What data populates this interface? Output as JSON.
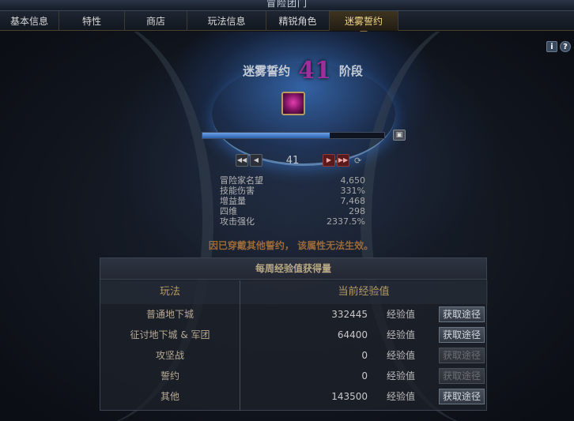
{
  "window": {
    "title": "冒险团门"
  },
  "tabs": [
    {
      "label": "基本信息",
      "active": false
    },
    {
      "label": "特性",
      "active": false
    },
    {
      "label": "商店",
      "active": false
    },
    {
      "label": "玩法信息",
      "active": false
    },
    {
      "label": "精锐角色",
      "active": false
    },
    {
      "label": "迷雾誓约",
      "active": true
    }
  ],
  "side_icons": {
    "info": "i",
    "help": "?"
  },
  "stage": {
    "title_prefix": "迷雾誓约",
    "number": "41",
    "title_suffix": "阶段",
    "progress_fraction": 0.7,
    "nav_value": "41",
    "nav_icons": [
      "first-icon",
      "prev-icon",
      "next-icon",
      "last-icon",
      "refresh-icon"
    ]
  },
  "stats": [
    {
      "label": "冒险家名望",
      "value": "4,650"
    },
    {
      "label": "技能伤害",
      "value": "331%"
    },
    {
      "label": "增益量",
      "value": "7,468"
    },
    {
      "label": "四维",
      "value": "298"
    },
    {
      "label": "攻击强化",
      "value": "2337.5%"
    }
  ],
  "warning": "因已穿戴其他誓约， 该属性无法生效。",
  "weekly": {
    "title": "每周经验值获得量",
    "col_mode": "玩法",
    "col_exp": "当前经验值",
    "rows": [
      {
        "name": "普通地下城",
        "value": "332445",
        "unit": "经验值",
        "button": "获取途径",
        "enabled": true
      },
      {
        "name": "征讨地下城 & 军团",
        "value": "64400",
        "unit": "经验值",
        "button": "获取途径",
        "enabled": true
      },
      {
        "name": "攻坚战",
        "value": "0",
        "unit": "经验值",
        "button": "获取途径",
        "enabled": false
      },
      {
        "name": "誓约",
        "value": "0",
        "unit": "经验值",
        "button": "获取途径",
        "enabled": false
      },
      {
        "name": "其他",
        "value": "143500",
        "unit": "经验值",
        "button": "获取途径",
        "enabled": true
      }
    ]
  },
  "colors": {
    "accent_gold": "#f4d88a",
    "stage_number": "#9b2f9b",
    "progress": "#4a86d0",
    "warning": "#9a6a3a"
  }
}
